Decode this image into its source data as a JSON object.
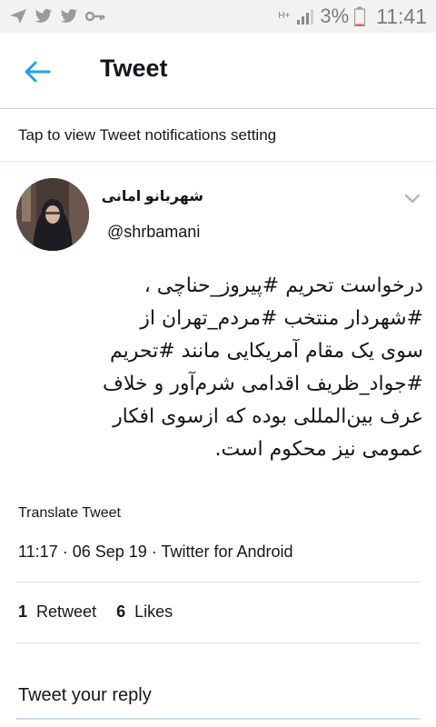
{
  "status_bar": {
    "left_icons": [
      "send-icon",
      "twitter-icon",
      "twitter-icon",
      "key-icon"
    ],
    "network_label": "H+",
    "battery_text": "3%",
    "time": "11:41"
  },
  "app_bar": {
    "title": "Tweet"
  },
  "notification_banner": {
    "text": "Tap to view Tweet notifications setting"
  },
  "tweet": {
    "author_name": "شهربانو امانی",
    "handle": "@shrbamani",
    "lines": [
      "درخواست تحریم #پیروز_حناچی ،",
      "#شهردار منتخب #مردم_تهران از",
      "سوی یک مقام آمریکایی مانند #تحریم",
      "#جواد_ظریف اقدامی شرم‌آور و خلاف",
      "عرف بین‌المللی بوده که ازسوی افکار",
      "عمومی نیز محکوم است."
    ],
    "translate_label": "Translate Tweet",
    "meta": "11:17 · 06 Sep 19 · Twitter for Android",
    "retweet_count": "1",
    "retweet_label": "Retweet",
    "likes_count": "6",
    "likes_label": "Likes"
  },
  "reply": {
    "placeholder": "Tweet your reply"
  },
  "colors": {
    "accent": "#1da1f2",
    "text": "#14171a",
    "divider": "#e1e8ed",
    "status_bar_bg": "#f2f2f2"
  }
}
